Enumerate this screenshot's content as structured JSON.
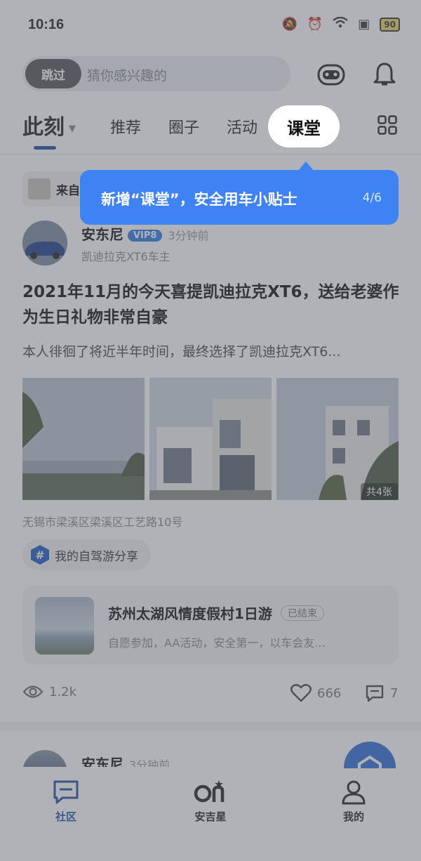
{
  "status_bar": {
    "time": "10:16",
    "battery": "90"
  },
  "search": {
    "skip_label": "跳过",
    "placeholder": "猜你感兴趣的"
  },
  "tabs": [
    {
      "label": "此刻",
      "active": true
    },
    {
      "label": "推荐"
    },
    {
      "label": "圈子"
    },
    {
      "label": "活动"
    },
    {
      "label": "课堂",
      "highlighted": true
    }
  ],
  "tooltip": {
    "message": "新增“课堂”，安全用车小贴士",
    "step": "4/6"
  },
  "feed": {
    "from_chip": "来自",
    "post": {
      "author": "安东尼",
      "vip": "VIP8",
      "time": "3分钟前",
      "subtitle": "凯迪拉克XT6车主",
      "title": "2021年11月的今天喜提凯迪拉克XT6，送给老婆作为生日礼物非常自豪",
      "excerpt": "本人徘徊了将近半年时间，最终选择了凯迪拉克XT6...",
      "photo_count": "共4张",
      "location": "无锡市梁溪区梁溪区工艺路10号",
      "topic": "我的自驾游分享",
      "event": {
        "title": "苏州太湖风情度假村1日游",
        "status": "已结束",
        "desc": "自愿参加，AA活动，安全第一，以车会友..."
      },
      "views": "1.2k",
      "likes": "666",
      "comments": "7"
    },
    "next_post": {
      "author": "安东尼",
      "time": "3分钟前"
    }
  },
  "bottom_nav": [
    {
      "label": "社区",
      "icon": "chat-icon",
      "active": true
    },
    {
      "label": "安吉星",
      "icon": "onstar-icon"
    },
    {
      "label": "我的",
      "icon": "user-icon"
    }
  ],
  "colors": {
    "accent": "#1d4fa3",
    "tooltip": "#3f82f3",
    "vip": "#2e7be6"
  }
}
